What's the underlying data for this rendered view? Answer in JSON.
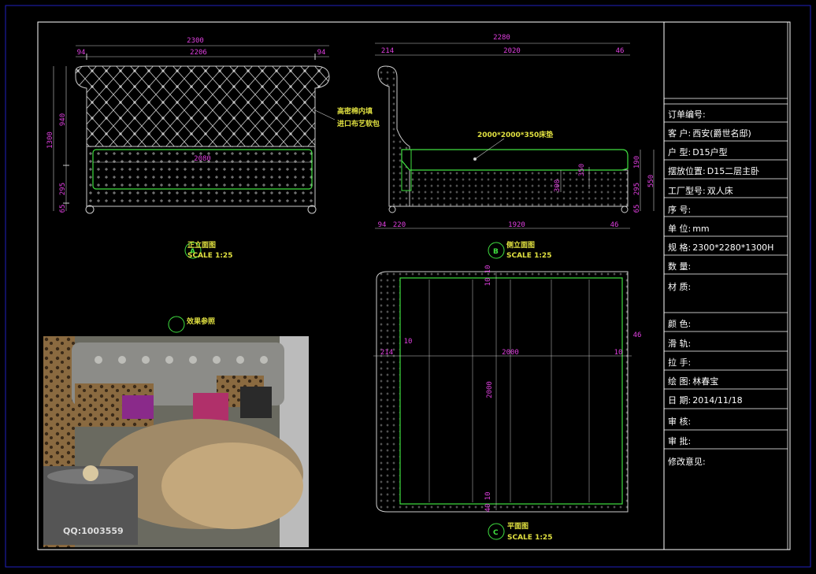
{
  "front_view": {
    "title": "正立面图",
    "scale": "SCALE 1:25",
    "bubble": "A",
    "dims": {
      "overall_width": "2300",
      "left_margin": "94",
      "inner_width": "2206",
      "right_margin": "94",
      "height_total": "1300",
      "headboard_upper": "940",
      "side_rail": "295",
      "leg": "65",
      "mattress_width": "2080"
    },
    "note_line1": "高密棉内填",
    "note_line2": "进口布艺软包"
  },
  "side_view": {
    "title": "侧立面图",
    "scale": "SCALE 1:25",
    "bubble": "B",
    "dims": {
      "overall_length": "2280",
      "head_depth": "214",
      "body": "2020",
      "foot": "46",
      "bottom_94": "94",
      "bottom_220": "220",
      "bottom_1920": "1920",
      "bottom_46": "46",
      "h190": "190",
      "h295": "295",
      "h65": "65",
      "h550": "550",
      "mattress_h": "350",
      "inner_h": "300"
    },
    "mattress_label": "2000*2000*350床垫"
  },
  "plan_view": {
    "title": "平面图",
    "scale": "SCALE 1:25",
    "bubble": "C",
    "dims": {
      "left": "214",
      "gap_left": "10",
      "width": "2000",
      "gap_right": "10",
      "right": "46",
      "length": "2000",
      "top_gap": "10",
      "top_gap2": "10",
      "bottom_gap": "40",
      "bottom_gap2": "10"
    }
  },
  "photo_ref": {
    "title": "效果参照",
    "watermark": "QQ:1003559"
  },
  "title_block": {
    "rows": [
      {
        "label": "订单编号:",
        "value": ""
      },
      {
        "label": "客    户:",
        "value": "西安(爵世名邸)"
      },
      {
        "label": "户    型:",
        "value": "D15户型"
      },
      {
        "label": "摆放位置:",
        "value": "D15二层主卧"
      },
      {
        "label": "工厂型号:",
        "value": "双人床"
      },
      {
        "label": "序    号:",
        "value": ""
      },
      {
        "label": "单    位:",
        "value": "mm"
      },
      {
        "label": "规    格:",
        "value": "2300*2280*1300H"
      },
      {
        "label": "数    量:",
        "value": ""
      },
      {
        "label": "材    质:",
        "value": ""
      },
      {
        "label": "颜    色:",
        "value": ""
      },
      {
        "label": "滑    轨:",
        "value": ""
      },
      {
        "label": "拉    手:",
        "value": ""
      },
      {
        "label": "绘    图:",
        "value": "林春宝"
      },
      {
        "label": "日    期:",
        "value": "2014/11/18"
      },
      {
        "label": "审    核:",
        "value": ""
      },
      {
        "label": "审    批:",
        "value": ""
      },
      {
        "label": "修改意见:",
        "value": ""
      }
    ]
  },
  "colors": {
    "border": "#2020c0",
    "frame": "#ffffff",
    "dimension": "#e040e0",
    "label": "#e0e040",
    "outline": "#40e040"
  }
}
